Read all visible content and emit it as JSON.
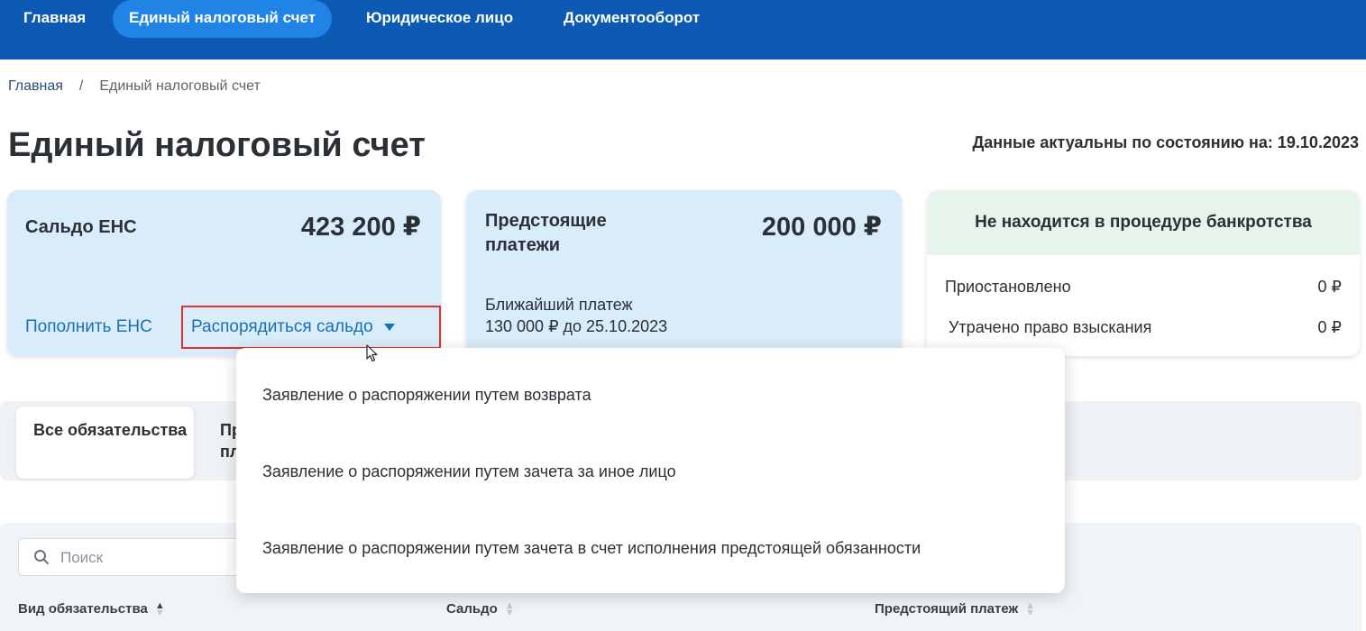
{
  "nav": {
    "items": [
      {
        "label": "Главная"
      },
      {
        "label": "Единый налоговый счет"
      },
      {
        "label": "Юридическое лицо"
      },
      {
        "label": "Документооборот"
      }
    ]
  },
  "breadcrumb": {
    "home": "Главная",
    "separator": "/",
    "current": "Единый налоговый счет"
  },
  "page": {
    "title": "Единый налоговый счет",
    "actual_date": "Данные актуальны по состоянию на: 19.10.2023"
  },
  "saldo_card": {
    "label": "Сальдо ЕНС",
    "amount": "423 200 ₽",
    "topup_link": "Пополнить ЕНС",
    "manage_link": "Распорядиться сальдо"
  },
  "upcoming_card": {
    "label": "Предстоящие платежи",
    "amount": "200 000 ₽",
    "nearest_label": "Ближайший платеж",
    "nearest_value": "130 000 ₽ до 25.10.2023"
  },
  "status_card": {
    "title": "Не находится в процедуре банкротства",
    "rows": [
      {
        "label": "Приостановлено",
        "value": "0 ₽"
      },
      {
        "label": "Утрачено право взыскания",
        "value": "0 ₽"
      }
    ]
  },
  "tabs": {
    "all": "Все обязательства",
    "second_partial": "Пр пл"
  },
  "table": {
    "search_placeholder": "Поиск",
    "columns": [
      "Вид обязательства",
      "Сальдо",
      "Предстоящий платеж"
    ]
  },
  "dropdown": {
    "items": [
      "Заявление о распоряжении путем возврата",
      "Заявление о распоряжении путем зачета за иное лицо",
      "Заявление о распоряжении путем зачета в счет исполнения предстоящей обязанности"
    ]
  },
  "colors": {
    "nav_bg": "#0c5ab4",
    "nav_active": "#1f84e6",
    "card_blue": "#d9ecfa",
    "status_green": "#e6f4ec",
    "link": "#1b6fb5",
    "highlight": "#e0312e"
  }
}
